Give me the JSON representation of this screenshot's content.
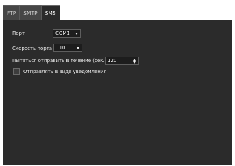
{
  "tabs": [
    {
      "label": "FTP",
      "active": false
    },
    {
      "label": "SMTP",
      "active": false
    },
    {
      "label": "SMS",
      "active": true
    }
  ],
  "form": {
    "port": {
      "label": "Порт",
      "value": "COM1"
    },
    "port_speed": {
      "label": "Скорость порта",
      "value": "110"
    },
    "retry": {
      "label": "Пытаться отправить в течение (сек.)",
      "value": "120"
    },
    "notify": {
      "label": "Отправлять в виде уведомления",
      "checked": false
    }
  },
  "colors": {
    "panel_bg": "#2b2b2b",
    "tab_bg": "#464646",
    "active_tab_bg": "#2a2a2a",
    "text": "#e6e6e6"
  }
}
